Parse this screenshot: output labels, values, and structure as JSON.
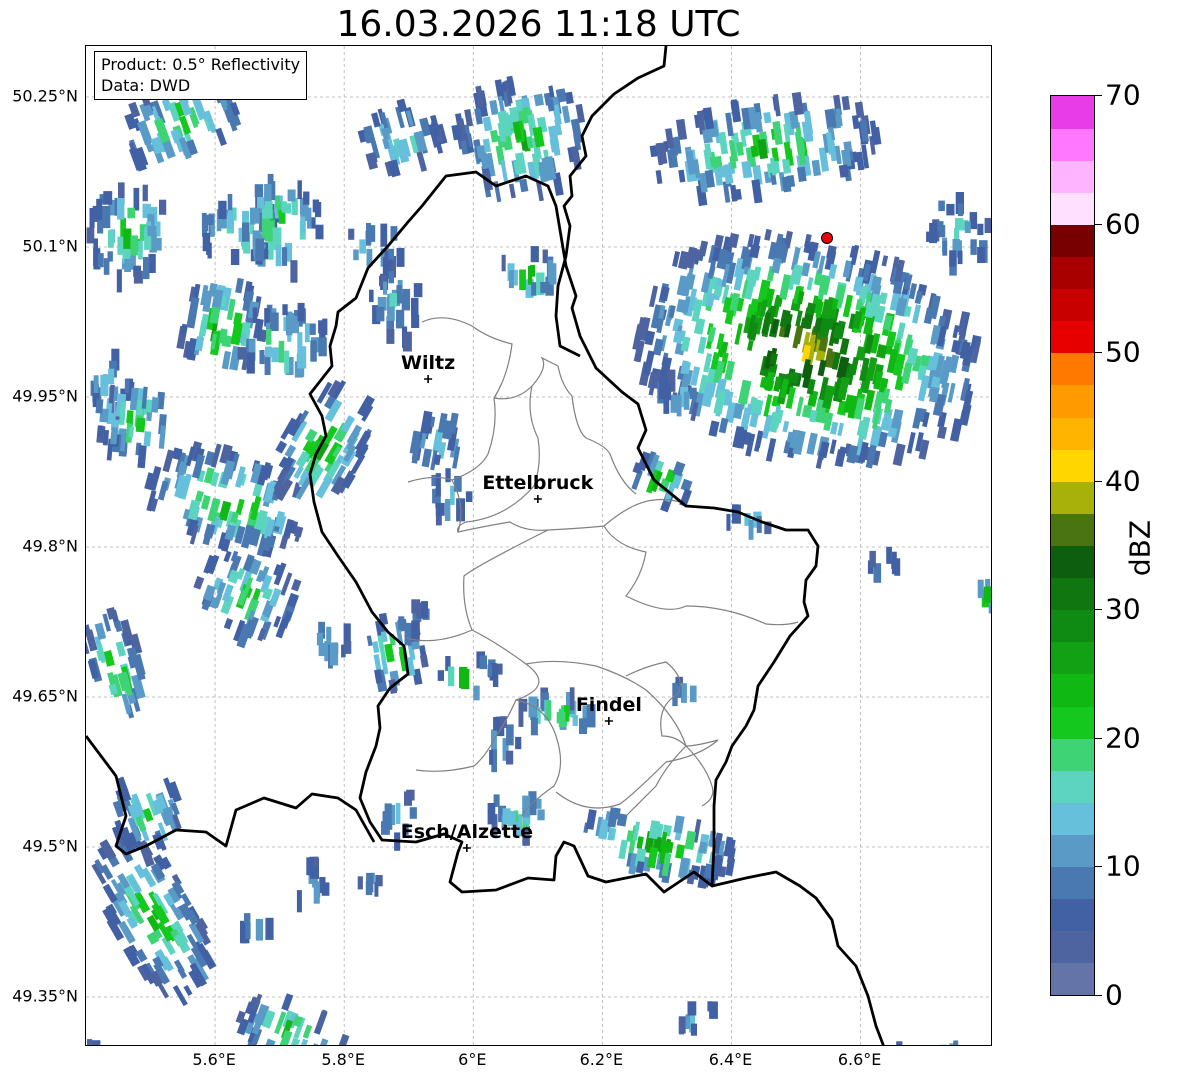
{
  "title": "16.03.2026 11:18 UTC",
  "info": {
    "product": "Product: 0.5° Reflectivity",
    "source": "Data: DWD"
  },
  "lat_ticks": [
    "50.25°N",
    "50.1°N",
    "49.95°N",
    "49.8°N",
    "49.65°N",
    "49.5°N",
    "49.35°N"
  ],
  "lon_ticks": [
    "5.6°E",
    "5.8°E",
    "6°E",
    "6.2°E",
    "6.4°E",
    "6.6°E"
  ],
  "cities": [
    {
      "name": "Wiltz",
      "lon": 5.93,
      "lat": 49.968
    },
    {
      "name": "Ettelbruck",
      "lon": 6.1,
      "lat": 49.848
    },
    {
      "name": "Findel",
      "lon": 6.21,
      "lat": 49.626
    },
    {
      "name": "Esch/Alzette",
      "lon": 5.99,
      "lat": 49.499
    }
  ],
  "radar_marker": {
    "lon": 6.548,
    "lat": 50.109,
    "color": "#e8000b"
  },
  "colorbar": {
    "label": "dBZ",
    "tick_labels": [
      "0",
      "10",
      "20",
      "30",
      "40",
      "50",
      "60",
      "70"
    ],
    "vmin": 0,
    "vmax": 70,
    "step": 2.5,
    "colors": [
      "#6474a8",
      "#4e64a0",
      "#4260a4",
      "#4a78b0",
      "#5a9ac6",
      "#66c0dc",
      "#5cd4c0",
      "#3ed476",
      "#14c81e",
      "#10b814",
      "#12a014",
      "#0f8a12",
      "#0f7610",
      "#0e5e10",
      "#4a7412",
      "#a8b00a",
      "#ffd600",
      "#ffb400",
      "#ff9a00",
      "#ff7800",
      "#e60000",
      "#c80000",
      "#a80000",
      "#780000",
      "#ffe0ff",
      "#ffb4ff",
      "#ff78ff",
      "#e83ce8"
    ]
  }
}
